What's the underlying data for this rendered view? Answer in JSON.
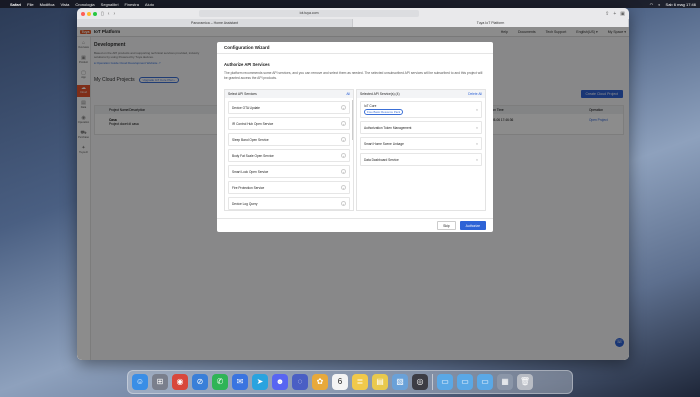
{
  "menubar": {
    "items": [
      "Safari",
      "File",
      "Modifica",
      "Vista",
      "Cronologia",
      "Segnalibri",
      "Finestra",
      "Aiuto"
    ],
    "clock": "Sab 6 mag  17:46"
  },
  "browser": {
    "address": "iot.tuya.com",
    "tabs": [
      "Panoramica – Home Assistant",
      "Tuya IoT Platform"
    ]
  },
  "app": {
    "logo_text": "Tuya",
    "name": "IoT Platform",
    "header_links": [
      "Help",
      "Documents",
      "Tech Support",
      "English(US) ▾",
      "My Space ▾"
    ],
    "nav": [
      {
        "label": "Overview",
        "icon": "⌂"
      },
      {
        "label": "Product",
        "icon": "▣"
      },
      {
        "label": "App",
        "icon": "▢"
      },
      {
        "label": "Cloud",
        "icon": "☁"
      },
      {
        "label": "Data",
        "icon": "▤"
      },
      {
        "label": "Operation",
        "icon": "◉"
      },
      {
        "label": "Purchase",
        "icon": "⛟"
      },
      {
        "label": "Tuya AI",
        "icon": "✦"
      }
    ],
    "section_title": "Development",
    "section_desc": "Based on the API products and supporting technical services provided, industry solutions by using Powered by Tuya devices.",
    "section_links": "● Operation Guide    Cloud Development Website ↗",
    "projects_title": "My Cloud Projects",
    "upgrade_tag": "Upgrade IoT Core Plan ›",
    "create_button": "Create Cloud Project",
    "table_header_name": "Project Name/Description",
    "table_header_time": "ation Time",
    "table_header_op": "Operation",
    "row_name": "Casa",
    "row_desc": "Project docet di casa",
    "row_time": "3-05-06 17:46:36",
    "row_op": "Open Project"
  },
  "modal": {
    "header": "Configuration Wizard",
    "title": "Authorize API Services",
    "desc": "The platform recommends some API services, and you can remove and select them as needed. The selected unsubscribed API services will be subscribed to and this project will be granted access the API products.",
    "left_header": "Select API Services",
    "left_action": "All",
    "left_items": [
      "Device OTA Update",
      "IR Control Hub Open Service",
      "Sleep Band Open Service",
      "Body Fat Scale Open Service",
      "Smart Lock Open Service",
      "Fire Protection Service",
      "Device Log Query"
    ],
    "right_header": "Selected API Service(s) (4)",
    "right_action": "Delete All",
    "selected_core": "IoT Core",
    "selected_core_plan": "Free Basic Resource Pack",
    "selected_items": [
      "Authorization Token Management",
      "Smart Home Scene Linkage",
      "Data Dashboard Service"
    ],
    "skip_label": "Skip",
    "authorize_label": "Authorize"
  },
  "dock": {
    "apps": [
      {
        "icon": "finder-icon",
        "glyph": "☺",
        "color": "#3a8ee6"
      },
      {
        "icon": "launchpad-icon",
        "glyph": "⊞",
        "color": "#7a7f8c"
      },
      {
        "icon": "chrome-icon",
        "glyph": "◉",
        "color": "#d8483c"
      },
      {
        "icon": "safari-icon",
        "glyph": "⊘",
        "color": "#3a7fd8"
      },
      {
        "icon": "whatsapp-icon",
        "glyph": "✆",
        "color": "#2fb457"
      },
      {
        "icon": "signal-icon",
        "glyph": "✉",
        "color": "#3a74e0"
      },
      {
        "icon": "telegram-icon",
        "glyph": "➤",
        "color": "#2aa3df"
      },
      {
        "icon": "discord-icon",
        "glyph": "☻",
        "color": "#5865f2"
      },
      {
        "icon": "arc-icon",
        "glyph": "◌",
        "color": "#4a5fc4"
      },
      {
        "icon": "photos-icon",
        "glyph": "✿",
        "color": "#e7a93b"
      },
      {
        "icon": "calendar-icon",
        "glyph": "6",
        "color": "#f4f4f4"
      },
      {
        "icon": "notes-icon",
        "glyph": "≣",
        "color": "#f1c94a"
      },
      {
        "icon": "stickies-icon",
        "glyph": "▤",
        "color": "#e9c94d"
      },
      {
        "icon": "preview-icon",
        "glyph": "▧",
        "color": "#6aa1d8"
      },
      {
        "icon": "quicktime-icon",
        "glyph": "◎",
        "color": "#3c3c44"
      }
    ],
    "folders": [
      {
        "icon": "downloads-folder-icon",
        "glyph": "▭",
        "color": "#5aa8e6"
      },
      {
        "icon": "documents-folder-icon",
        "glyph": "▭",
        "color": "#5aa8e6"
      },
      {
        "icon": "applications-folder-icon",
        "glyph": "▭",
        "color": "#5aa8e6"
      },
      {
        "icon": "screenshot-icon",
        "glyph": "▦",
        "color": "#8b96a8"
      },
      {
        "icon": "trash-icon",
        "glyph": "🗑",
        "color": "#b8bcc4"
      }
    ]
  }
}
